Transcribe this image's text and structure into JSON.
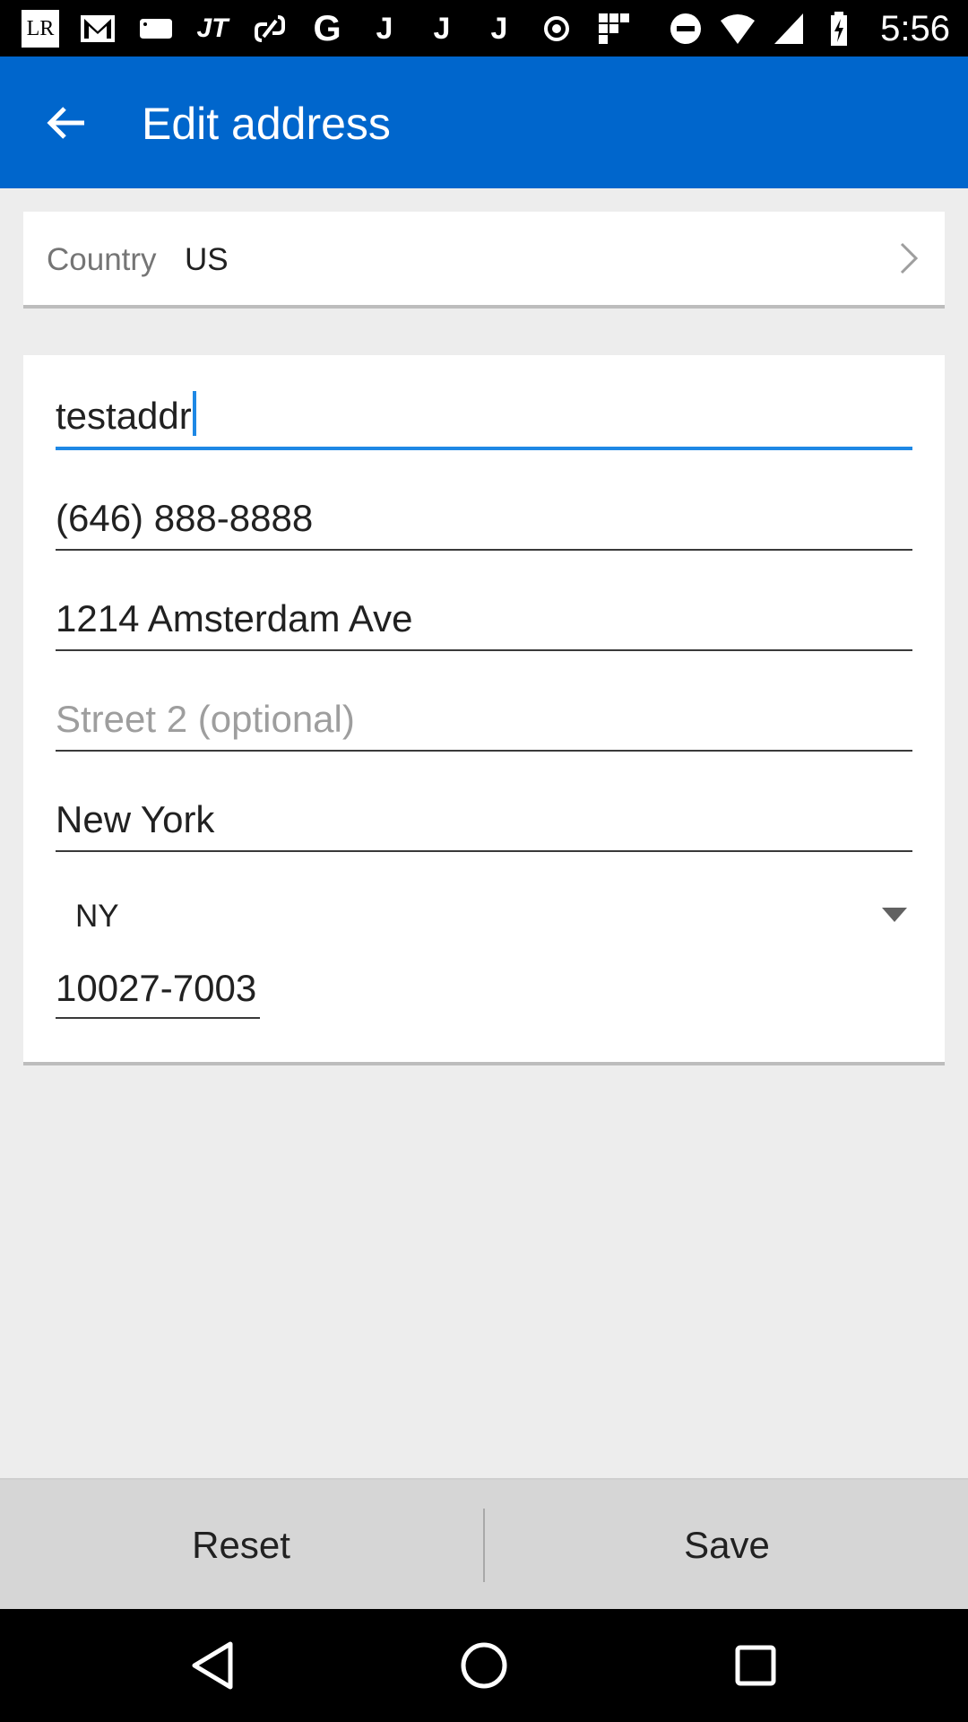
{
  "status_bar": {
    "time": "5:56",
    "notification_icons": [
      "lr-icon",
      "gmail-icon",
      "tag-icon",
      "jt-icon",
      "link-icon",
      "google-icon",
      "j-icon",
      "j-icon",
      "j-icon",
      "circle-dot-icon",
      "grid-icon"
    ],
    "system_icons": [
      "do-not-disturb-icon",
      "wifi-icon",
      "signal-icon",
      "battery-charging-icon"
    ],
    "lr_text": "LR",
    "jt_text": "JT",
    "g_text": "G",
    "j_text": "J"
  },
  "app_bar": {
    "title": "Edit address",
    "color": "#0066cc"
  },
  "country": {
    "label": "Country",
    "value": "US"
  },
  "form": {
    "name": {
      "value": "testaddr",
      "focused": true
    },
    "phone": {
      "value": "(646) 888-8888"
    },
    "street1": {
      "value": "1214 Amsterdam Ave"
    },
    "street2": {
      "value": "",
      "placeholder": "Street 2 (optional)"
    },
    "city": {
      "value": "New York"
    },
    "state": {
      "value": "NY"
    },
    "zip": {
      "value": "10027-7003"
    }
  },
  "actions": {
    "reset_label": "Reset",
    "save_label": "Save"
  },
  "nav_bar": {
    "buttons": [
      "back-triangle-icon",
      "home-circle-icon",
      "recents-square-icon"
    ]
  }
}
